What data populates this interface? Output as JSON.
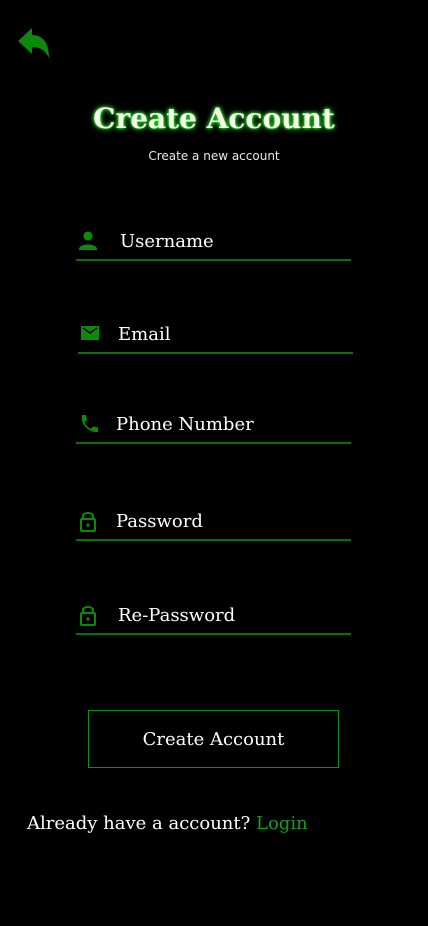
{
  "header": {
    "title": "Create Account",
    "subtitle": "Create a new account"
  },
  "form": {
    "username_placeholder": "Username",
    "email_placeholder": "Email",
    "phone_placeholder": "Phone Number",
    "password_placeholder": "Password",
    "repassword_placeholder": "Re-Password"
  },
  "actions": {
    "create_label": "Create Account"
  },
  "footer": {
    "prompt": "Already have a account?",
    "login_label": "Login"
  },
  "colors": {
    "accent": "#0c8a0c",
    "background": "#000000",
    "text": "#ffffff"
  },
  "icons": [
    "back-arrow-icon",
    "user-icon",
    "mail-icon",
    "phone-icon",
    "lock-icon"
  ]
}
